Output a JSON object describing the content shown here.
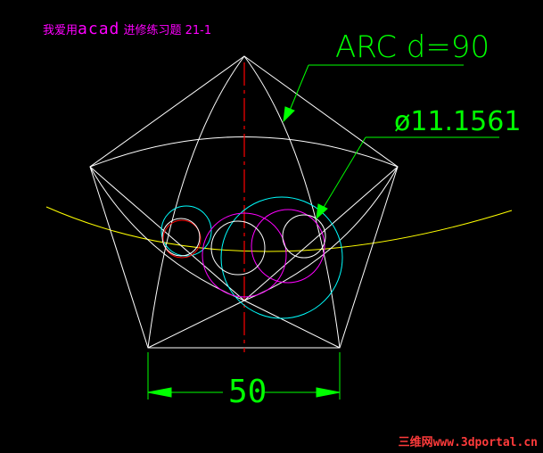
{
  "title": {
    "prefix": "我爱用",
    "app": "acad",
    "suffix": " 进修练习题 21-1"
  },
  "callout_arc": "ARC d=90",
  "callout_diameter": "ø11.1561",
  "dimension": "50",
  "watermark": "三维网www.3dportal.cn",
  "colors": {
    "background": "#000000",
    "geometry": "#ffffff",
    "centerline": "#ff0000",
    "arc": "#ffff00",
    "cyan_circle": "#00ffff",
    "magenta_circle": "#ff00ff",
    "red_circle": "#ff0000",
    "annotation": "#00ff00",
    "title": "#ff00ff"
  }
}
